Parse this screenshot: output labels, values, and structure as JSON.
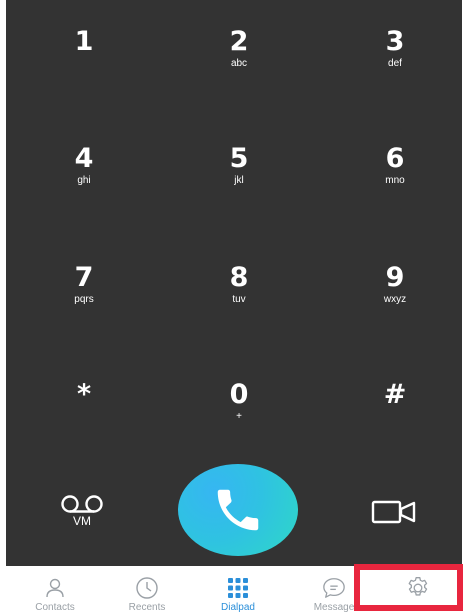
{
  "dialpad": {
    "keys": [
      {
        "digit": "1",
        "letters": ""
      },
      {
        "digit": "2",
        "letters": "abc"
      },
      {
        "digit": "3",
        "letters": "def"
      },
      {
        "digit": "4",
        "letters": "ghi"
      },
      {
        "digit": "5",
        "letters": "jkl"
      },
      {
        "digit": "6",
        "letters": "mno"
      },
      {
        "digit": "7",
        "letters": "pqrs"
      },
      {
        "digit": "8",
        "letters": "tuv"
      },
      {
        "digit": "9",
        "letters": "wxyz"
      },
      {
        "digit": "*",
        "letters": ""
      },
      {
        "digit": "0",
        "letters": "+"
      },
      {
        "digit": "#",
        "letters": ""
      }
    ],
    "voicemail_label": "VM",
    "call_icon": "phone-icon",
    "video_icon": "video-camera-icon",
    "background_color": "#333333",
    "call_gradient": [
      "#36b6f2",
      "#2fd8c6"
    ]
  },
  "tabbar": {
    "tabs": [
      {
        "label": "Contacts",
        "icon": "person-icon",
        "active": false
      },
      {
        "label": "Recents",
        "icon": "clock-icon",
        "active": false
      },
      {
        "label": "Dialpad",
        "icon": "dialpad-grid-icon",
        "active": true
      },
      {
        "label": "Message",
        "icon": "message-bubble-icon",
        "active": false
      }
    ],
    "settings_icon": "gear-icon",
    "active_color": "#2b8fd9",
    "inactive_color": "#9aa0a6",
    "highlight_color": "#e8263e"
  }
}
